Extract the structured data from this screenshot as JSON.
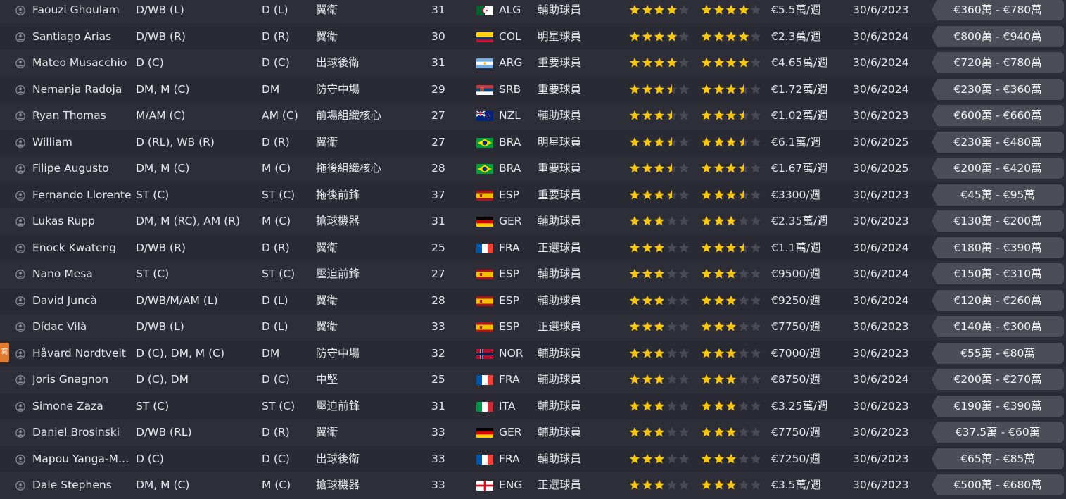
{
  "colors": {
    "star_full": "#f5c518",
    "star_empty": "#4a4a55",
    "value_badge": "#4d4d58",
    "tab_accent": "#e07a2e"
  },
  "side_tab_label": "寫",
  "players": [
    {
      "name": "Faouzi Ghoulam",
      "pos": "D/WB (L)",
      "pos2": "D (L)",
      "role": "翼衛",
      "age": "31",
      "nat": "ALG",
      "flag": "flag-algeria",
      "status": "輔助球員",
      "ability": 4,
      "potential": 4,
      "wage": "€5.5萬/週",
      "expires": "30/6/2023",
      "value": "€360萬 - €780萬"
    },
    {
      "name": "Santiago Arias",
      "pos": "D/WB (R)",
      "pos2": "D (R)",
      "role": "翼衛",
      "age": "30",
      "nat": "COL",
      "flag": "flag-colombia",
      "status": "明星球員",
      "ability": 4,
      "potential": 4,
      "wage": "€2.3萬/週",
      "expires": "30/6/2024",
      "value": "€800萬 - €940萬"
    },
    {
      "name": "Mateo Musacchio",
      "pos": "D (C)",
      "pos2": "D (C)",
      "role": "出球後衛",
      "age": "31",
      "nat": "ARG",
      "flag": "flag-argentina",
      "status": "重要球員",
      "ability": 4,
      "potential": 4,
      "wage": "€4.65萬/週",
      "expires": "30/6/2024",
      "value": "€720萬 - €780萬"
    },
    {
      "name": "Nemanja Radoja",
      "pos": "DM, M (C)",
      "pos2": "DM",
      "role": "防守中場",
      "age": "29",
      "nat": "SRB",
      "flag": "flag-serbia",
      "status": "重要球員",
      "ability": 3.5,
      "potential": 3.5,
      "wage": "€1.72萬/週",
      "expires": "30/6/2024",
      "value": "€230萬 - €360萬"
    },
    {
      "name": "Ryan Thomas",
      "pos": "M/AM (C)",
      "pos2": "AM (C)",
      "role": "前場組織核心",
      "age": "27",
      "nat": "NZL",
      "flag": "flag-new-zealand",
      "status": "輔助球員",
      "ability": 3.5,
      "potential": 3.5,
      "wage": "€1.02萬/週",
      "expires": "30/6/2023",
      "value": "€600萬 - €660萬"
    },
    {
      "name": "William",
      "pos": "D (RL), WB (R)",
      "pos2": "D (R)",
      "role": "翼衛",
      "age": "27",
      "nat": "BRA",
      "flag": "flag-brazil",
      "status": "明星球員",
      "ability": 3.5,
      "potential": 3.5,
      "wage": "€6.1萬/週",
      "expires": "30/6/2025",
      "value": "€230萬 - €480萬"
    },
    {
      "name": "Filipe Augusto",
      "pos": "DM, M (C)",
      "pos2": "M (C)",
      "role": "拖後組織核心",
      "age": "28",
      "nat": "BRA",
      "flag": "flag-brazil",
      "status": "重要球員",
      "ability": 3.5,
      "potential": 3.5,
      "wage": "€1.67萬/週",
      "expires": "30/6/2025",
      "value": "€200萬 - €420萬"
    },
    {
      "name": "Fernando Llorente",
      "pos": "ST (C)",
      "pos2": "ST (C)",
      "role": "拖後前鋒",
      "age": "37",
      "nat": "ESP",
      "flag": "flag-spain",
      "status": "重要球員",
      "ability": 3.5,
      "potential": 3.5,
      "wage": "€3300/週",
      "expires": "30/6/2023",
      "value": "€45萬 - €95萬"
    },
    {
      "name": "Lukas Rupp",
      "pos": "DM, M (RC), AM (R)",
      "pos2": "M (C)",
      "role": "搶球機器",
      "age": "31",
      "nat": "GER",
      "flag": "flag-germany",
      "status": "輔助球員",
      "ability": 3,
      "potential": 3,
      "wage": "€2.35萬/週",
      "expires": "30/6/2023",
      "value": "€130萬 - €200萬"
    },
    {
      "name": "Enock Kwateng",
      "pos": "D/WB (R)",
      "pos2": "D (R)",
      "role": "翼衛",
      "age": "25",
      "nat": "FRA",
      "flag": "flag-france",
      "status": "正選球員",
      "ability": 3,
      "potential": 3.5,
      "wage": "€1.1萬/週",
      "expires": "30/6/2024",
      "value": "€180萬 - €390萬"
    },
    {
      "name": "Nano Mesa",
      "pos": "ST (C)",
      "pos2": "ST (C)",
      "role": "壓迫前鋒",
      "age": "27",
      "nat": "ESP",
      "flag": "flag-spain",
      "status": "輔助球員",
      "ability": 3,
      "potential": 3,
      "wage": "€9500/週",
      "expires": "30/6/2024",
      "value": "€150萬 - €310萬"
    },
    {
      "name": "David Juncà",
      "pos": "D/WB/M/AM (L)",
      "pos2": "D (L)",
      "role": "翼衛",
      "age": "28",
      "nat": "ESP",
      "flag": "flag-spain",
      "status": "輔助球員",
      "ability": 3,
      "potential": 3,
      "wage": "€9250/週",
      "expires": "30/6/2024",
      "value": "€120萬 - €260萬"
    },
    {
      "name": "Dídac Vilà",
      "pos": "D/WB (L)",
      "pos2": "D (L)",
      "role": "翼衛",
      "age": "33",
      "nat": "ESP",
      "flag": "flag-spain",
      "status": "正選球員",
      "ability": 3,
      "potential": 3,
      "wage": "€7750/週",
      "expires": "30/6/2023",
      "value": "€140萬 - €300萬"
    },
    {
      "name": "Håvard Nordtveit",
      "pos": "D (C), DM, M (C)",
      "pos2": "DM",
      "role": "防守中場",
      "age": "32",
      "nat": "NOR",
      "flag": "flag-norway",
      "status": "輔助球員",
      "ability": 3,
      "potential": 3,
      "wage": "€7000/週",
      "expires": "30/6/2023",
      "value": "€55萬 - €80萬"
    },
    {
      "name": "Joris Gnagnon",
      "pos": "D (C), DM",
      "pos2": "D (C)",
      "role": "中堅",
      "age": "25",
      "nat": "FRA",
      "flag": "flag-france",
      "status": "輔助球員",
      "ability": 3,
      "potential": 3,
      "wage": "€8750/週",
      "expires": "30/6/2024",
      "value": "€200萬 - €270萬"
    },
    {
      "name": "Simone Zaza",
      "pos": "ST (C)",
      "pos2": "ST (C)",
      "role": "壓迫前鋒",
      "age": "31",
      "nat": "ITA",
      "flag": "flag-italy",
      "status": "輔助球員",
      "ability": 3,
      "potential": 3,
      "wage": "€3.25萬/週",
      "expires": "30/6/2023",
      "value": "€190萬 - €390萬"
    },
    {
      "name": "Daniel Brosinski",
      "pos": "D/WB (RL)",
      "pos2": "D (R)",
      "role": "翼衛",
      "age": "33",
      "nat": "GER",
      "flag": "flag-germany",
      "status": "輔助球員",
      "ability": 3,
      "potential": 3,
      "wage": "€7750/週",
      "expires": "30/6/2023",
      "value": "€37.5萬 - €60萬"
    },
    {
      "name": "Mapou Yanga-Mb...",
      "pos": "D (C)",
      "pos2": "D (C)",
      "role": "出球後衛",
      "age": "33",
      "nat": "FRA",
      "flag": "flag-france",
      "status": "輔助球員",
      "ability": 3,
      "potential": 3,
      "wage": "€7250/週",
      "expires": "30/6/2023",
      "value": "€65萬 - €85萬"
    },
    {
      "name": "Dale Stephens",
      "pos": "DM, M (C)",
      "pos2": "M (C)",
      "role": "搶球機器",
      "age": "33",
      "nat": "ENG",
      "flag": "flag-england",
      "status": "正選球員",
      "ability": 3,
      "potential": 3,
      "wage": "€3.5萬/週",
      "expires": "30/6/2023",
      "value": "€500萬 - €680萬"
    }
  ]
}
